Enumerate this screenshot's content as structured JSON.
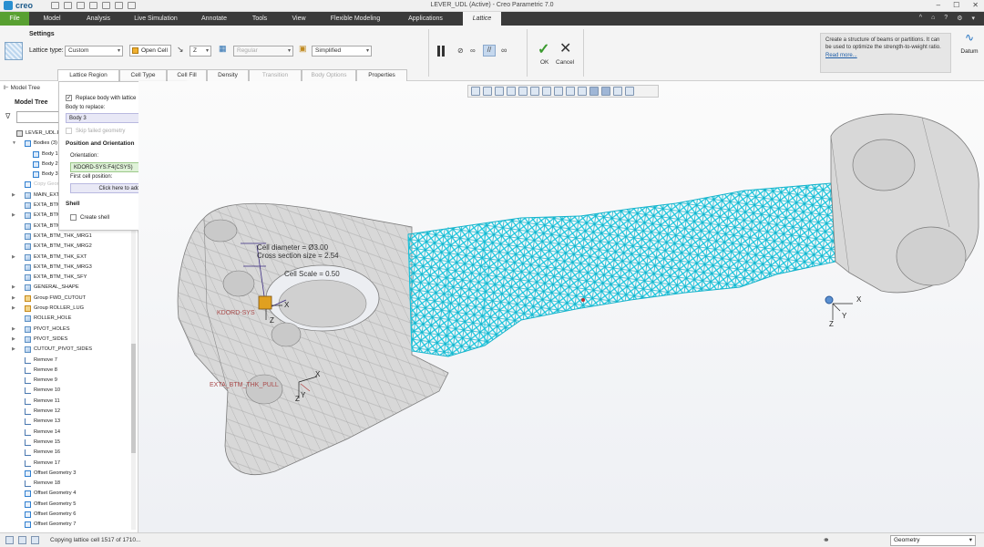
{
  "window": {
    "title": "LEVER_UDL (Active) - Creo Parametric 7.0",
    "brand": "creo",
    "controls": [
      "–",
      "☐",
      "✕"
    ]
  },
  "menu": {
    "file": "File",
    "tabs": [
      "Model",
      "Analysis",
      "Live Simulation",
      "Annotate",
      "Tools",
      "View",
      "Flexible Modeling",
      "Applications"
    ],
    "active_tab": "Lattice",
    "right_icons": [
      "^",
      "⌂",
      "?",
      "⚙",
      "▾"
    ]
  },
  "ribbon": {
    "settings": "Settings",
    "lattice_type_label": "Lattice type:",
    "lattice_type": "Custom",
    "open_cell": "Open Cell",
    "axis": "Z",
    "regular": "Regular",
    "simplified": "Simplified",
    "ok": "OK",
    "cancel": "Cancel",
    "help_text": "Create a structure of beams or partitions. It can be used to optimize the strength-to-weight ratio.",
    "help_link": "Read more...",
    "datum": "Datum",
    "subtabs": [
      "Lattice Region",
      "Cell Type",
      "Cell Fill",
      "Density",
      "Transition",
      "Body Options",
      "Properties"
    ]
  },
  "tree": {
    "tab": "Model Tree",
    "title": "Model Tree",
    "items": [
      {
        "label": "LEVER_UDL.PRT",
        "icon": "part-icon",
        "indent": 0,
        "expander": ""
      },
      {
        "label": "Bodies (3)",
        "icon": "bodies-icon",
        "indent": 1,
        "expander": "▼"
      },
      {
        "label": "Body 1",
        "icon": "body-icon",
        "indent": 2,
        "expander": ""
      },
      {
        "label": "Body 2",
        "icon": "body-icon",
        "indent": 2,
        "expander": ""
      },
      {
        "label": "Body 3",
        "icon": "body-icon",
        "indent": 2,
        "expander": ""
      },
      {
        "label": "Copy Geom",
        "icon": "copy-geom-icon",
        "indent": 1,
        "expander": "",
        "faded": true
      },
      {
        "label": "MAIN_EXTR",
        "icon": "extrude-icon",
        "indent": 1,
        "expander": "▶"
      },
      {
        "label": "EXTA_BTM_T",
        "icon": "extrude-icon",
        "indent": 1,
        "expander": ""
      },
      {
        "label": "EXTA_BTM_T",
        "icon": "extrude-icon",
        "indent": 1,
        "expander": "▶"
      },
      {
        "label": "EXTA_BTM_T",
        "icon": "extrude-icon",
        "indent": 1,
        "expander": ""
      },
      {
        "label": "EXTA_BTM_THK_MRG1",
        "icon": "merge-icon",
        "indent": 1,
        "expander": ""
      },
      {
        "label": "EXTA_BTM_THK_MRG2",
        "icon": "merge-icon",
        "indent": 1,
        "expander": ""
      },
      {
        "label": "EXTA_BTM_THK_EXT",
        "icon": "extrude-icon",
        "indent": 1,
        "expander": "▶"
      },
      {
        "label": "EXTA_BTM_THK_MRG3",
        "icon": "merge-icon",
        "indent": 1,
        "expander": ""
      },
      {
        "label": "EXTA_BTM_THK_SFY",
        "icon": "sfy-icon",
        "indent": 1,
        "expander": ""
      },
      {
        "label": "GENERAL_SHAPE",
        "icon": "extrude-icon",
        "indent": 1,
        "expander": "▶"
      },
      {
        "label": "Group FWD_CUTOUT",
        "icon": "group-icon",
        "indent": 1,
        "expander": "▶"
      },
      {
        "label": "Group ROLLER_LUG",
        "icon": "group-icon",
        "indent": 1,
        "expander": "▶"
      },
      {
        "label": "ROLLER_HOLE",
        "icon": "hole-icon",
        "indent": 1,
        "expander": ""
      },
      {
        "label": "PIVOT_HOLES",
        "icon": "extrude-icon",
        "indent": 1,
        "expander": "▶"
      },
      {
        "label": "PIVOT_SIDES",
        "icon": "extrude-icon",
        "indent": 1,
        "expander": "▶"
      },
      {
        "label": "CUTOUT_PIVOT_SIDES",
        "icon": "extrude-icon",
        "indent": 1,
        "expander": "▶"
      },
      {
        "label": "Remove 7",
        "icon": "remove-icon",
        "indent": 1,
        "expander": ""
      },
      {
        "label": "Remove 8",
        "icon": "remove-icon",
        "indent": 1,
        "expander": ""
      },
      {
        "label": "Remove 9",
        "icon": "remove-icon",
        "indent": 1,
        "expander": ""
      },
      {
        "label": "Remove 10",
        "icon": "remove-icon",
        "indent": 1,
        "expander": ""
      },
      {
        "label": "Remove 11",
        "icon": "remove-icon",
        "indent": 1,
        "expander": ""
      },
      {
        "label": "Remove 12",
        "icon": "remove-icon",
        "indent": 1,
        "expander": ""
      },
      {
        "label": "Remove 13",
        "icon": "remove-icon",
        "indent": 1,
        "expander": ""
      },
      {
        "label": "Remove 14",
        "icon": "remove-icon",
        "indent": 1,
        "expander": ""
      },
      {
        "label": "Remove 15",
        "icon": "remove-icon",
        "indent": 1,
        "expander": ""
      },
      {
        "label": "Remove 16",
        "icon": "remove-icon",
        "indent": 1,
        "expander": ""
      },
      {
        "label": "Remove 17",
        "icon": "remove-icon",
        "indent": 1,
        "expander": ""
      },
      {
        "label": "Offset Geometry 3",
        "icon": "offset-icon",
        "indent": 1,
        "expander": ""
      },
      {
        "label": "Remove 18",
        "icon": "remove-icon",
        "indent": 1,
        "expander": ""
      },
      {
        "label": "Offset Geometry 4",
        "icon": "offset-icon",
        "indent": 1,
        "expander": ""
      },
      {
        "label": "Offset Geometry 5",
        "icon": "offset-icon",
        "indent": 1,
        "expander": ""
      },
      {
        "label": "Offset Geometry 6",
        "icon": "offset-icon",
        "indent": 1,
        "expander": ""
      },
      {
        "label": "Offset Geometry 7",
        "icon": "offset-icon",
        "indent": 1,
        "expander": ""
      }
    ]
  },
  "panel": {
    "replace_body": "Replace body with lattice",
    "body_to_replace_label": "Body to replace:",
    "body_to_replace": "Body 3",
    "skip_failed": "Skip failed geometry",
    "position_header": "Position and Orientation",
    "orientation_label": "Orientation:",
    "orientation": "KDORD-SYS:F4(CSYS)",
    "first_cell_label": "First cell position:",
    "first_cell": "Click here to add item",
    "shell_header": "Shell",
    "create_shell": "Create shell"
  },
  "viewport": {
    "annotations": {
      "cell_diameter": "Cell diameter = Ø3.00",
      "cross_section": "Cross section size = 2.54",
      "cell_scale": "Cell Scale  = 0.50",
      "csys_name": "KDORD-SYS",
      "exta_label": "EXTA_BTM_THK_PULL"
    },
    "axes": {
      "x": "X",
      "y": "Y",
      "z": "Z"
    },
    "colors": {
      "lattice": "#19c5dd",
      "body": "#d6d6d6",
      "edge": "#8a8a8a"
    }
  },
  "status": {
    "message": "Copying lattice cell 1517 of 1710...",
    "filter": "Geometry"
  }
}
